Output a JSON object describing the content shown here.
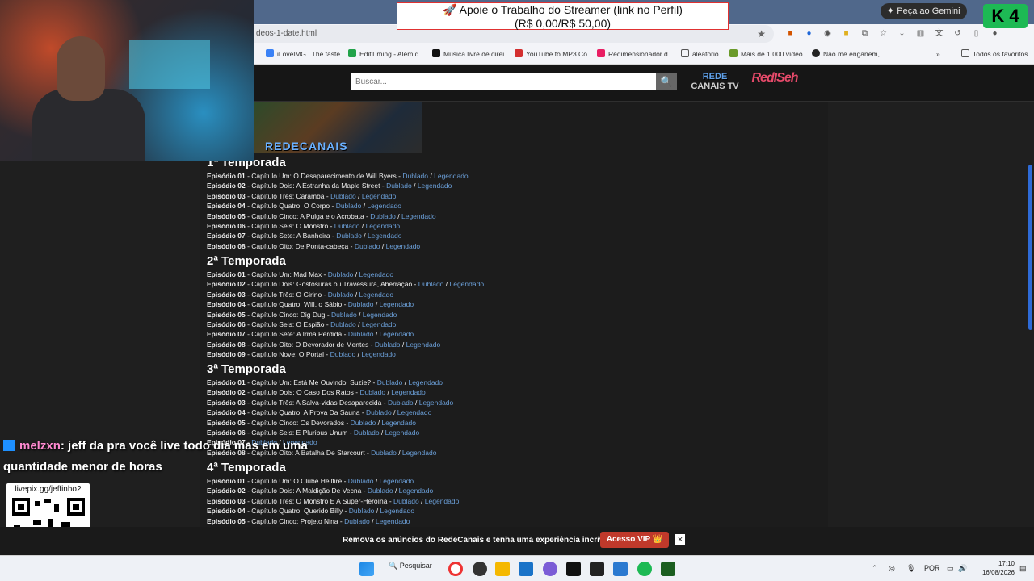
{
  "browser": {
    "url": "deos-1-date.html",
    "gemini_label": "Peça ao Gemini",
    "bookmarks": [
      "iLovelMG | The faste...",
      "EditTiming - Além d...",
      "Música livre de direi...",
      "YouTube to MP3 Co...",
      "Redimensionador d...",
      "aleatorio",
      "Mais de 1.000 vídeo...",
      "Não me enganem,...",
      "Todos os favoritos"
    ]
  },
  "overlay": {
    "donate_line1": "🚀 Apoie o Trabalho do Streamer (link no Perfil)",
    "donate_line2": "(R$ 0,00/R$ 50,00)",
    "k4": "K 4",
    "chat_user": "melzxn",
    "chat_message": ": jeff da pra você live todo dia mas em uma quantidade menor de horas",
    "qr_label": "livepix.gg/jeffinho2"
  },
  "site": {
    "search_placeholder": "Buscar...",
    "search_icon": "🔍",
    "logo_line1": "REDE",
    "logo_line2": "CANAIS TV",
    "logo_line3": "RedISeh",
    "poster_title": "REDECANAIS",
    "dub": "Dublado",
    "leg": "Legendado",
    "seasons": [
      {
        "title": "1ª Temporada",
        "episodes": [
          [
            "Episódio 01",
            "Capítulo Um: O Desaparecimento de Will Byers"
          ],
          [
            "Episódio 02",
            "Capítulo Dois: A Estranha da Maple Street"
          ],
          [
            "Episódio 03",
            "Capítulo Três: Caramba"
          ],
          [
            "Episódio 04",
            "Capítulo Quatro: O Corpo"
          ],
          [
            "Episódio 05",
            "Capítulo Cinco: A Pulga e o Acrobata"
          ],
          [
            "Episódio 06",
            "Capítulo Seis: O Monstro"
          ],
          [
            "Episódio 07",
            "Capítulo Sete: A Banheira"
          ],
          [
            "Episódio 08",
            "Capítulo Oito: De Ponta-cabeça"
          ]
        ]
      },
      {
        "title": "2ª Temporada",
        "episodes": [
          [
            "Episódio 01",
            "Capítulo Um: Mad Max"
          ],
          [
            "Episódio 02",
            "Capítulo Dois: Gostosuras ou Travessura, Aberração"
          ],
          [
            "Episódio 03",
            "Capítulo Três: O Girino"
          ],
          [
            "Episódio 04",
            "Capítulo Quatro: Will, o Sábio"
          ],
          [
            "Episódio 05",
            "Capítulo Cinco: Dig Dug"
          ],
          [
            "Episódio 06",
            "Capítulo Seis: O Espião"
          ],
          [
            "Episódio 07",
            "Capítulo Sete: A Irmã Perdida"
          ],
          [
            "Episódio 08",
            "Capítulo Oito: O Devorador de Mentes"
          ],
          [
            "Episódio 09",
            "Capítulo Nove: O Portal"
          ]
        ]
      },
      {
        "title": "3ª Temporada",
        "episodes": [
          [
            "Episódio 01",
            "Capítulo Um: Está Me Ouvindo, Suzie?"
          ],
          [
            "Episódio 02",
            "Capítulo Dois: O Caso Dos Ratos"
          ],
          [
            "Episódio 03",
            "Capítulo Três: A Salva-vidas Desaparecida"
          ],
          [
            "Episódio 04",
            "Capítulo Quatro: A Prova Da Sauna"
          ],
          [
            "Episódio 05",
            "Capítulo Cinco: Os Devorados"
          ],
          [
            "Episódio 06",
            "Capítulo Seis: E Pluribus Unum"
          ],
          [
            "Episódio 07",
            ""
          ],
          [
            "Episódio 08",
            "Capítulo Oito: A Batalha De Starcourt"
          ]
        ]
      },
      {
        "title": "4ª Temporada",
        "episodes": [
          [
            "Episódio 01",
            "Capítulo Um: O Clube Hellfire"
          ],
          [
            "Episódio 02",
            "Capítulo Dois: A Maldição De Vecna"
          ],
          [
            "Episódio 03",
            "Capítulo Três: O Monstro E A Super-Heroína"
          ],
          [
            "Episódio 04",
            "Capítulo Quatro: Querido Billy"
          ],
          [
            "Episódio 05",
            "Capítulo Cinco: Projeto Nina"
          ]
        ]
      }
    ]
  },
  "vip": {
    "text": "Remova os anúncios do RedeCanais e tenha uma experiência incrível!",
    "button": "Acesso VIP 👑",
    "close": "×"
  },
  "taskbar": {
    "search": "Pesquisar",
    "lang": "POR",
    "time": "17:10",
    "date": "16/08/2026"
  }
}
